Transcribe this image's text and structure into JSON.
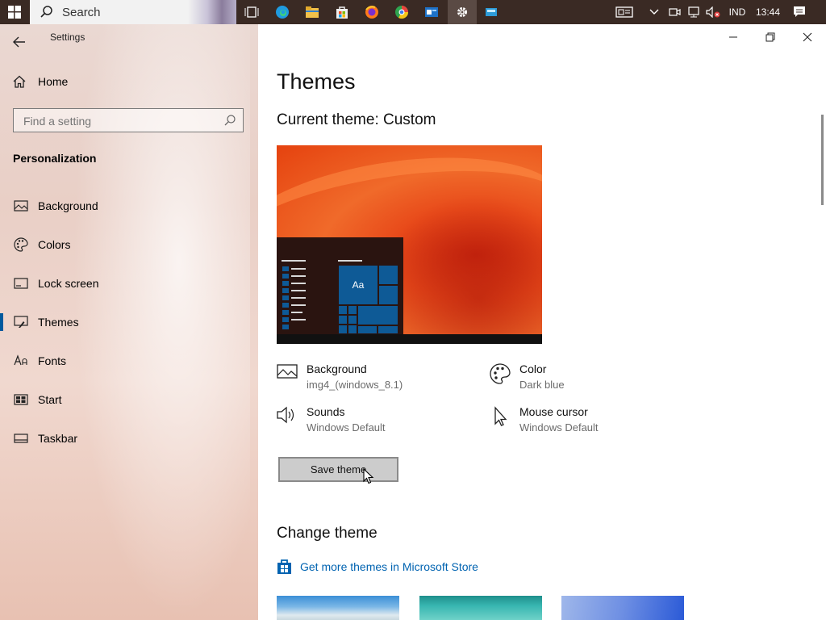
{
  "taskbar": {
    "search_label": "Search",
    "language": "IND",
    "clock": "13:44"
  },
  "window": {
    "title": "Settings"
  },
  "sidebar": {
    "home_label": "Home",
    "search_placeholder": "Find a setting",
    "section_title": "Personalization",
    "items": [
      {
        "label": "Background",
        "icon": "picture-icon"
      },
      {
        "label": "Colors",
        "icon": "palette-icon"
      },
      {
        "label": "Lock screen",
        "icon": "lock-screen-icon"
      },
      {
        "label": "Themes",
        "icon": "themes-brush-icon",
        "selected": true
      },
      {
        "label": "Fonts",
        "icon": "fonts-icon"
      },
      {
        "label": "Start",
        "icon": "start-icon"
      },
      {
        "label": "Taskbar",
        "icon": "taskbar-icon"
      }
    ]
  },
  "main": {
    "title": "Themes",
    "current_theme": "Current theme: Custom",
    "preview_tile_text": "Aa",
    "attributes": {
      "background": {
        "name": "Background",
        "value": "img4_(windows_8.1)"
      },
      "color": {
        "name": "Color",
        "value": "Dark blue"
      },
      "sounds": {
        "name": "Sounds",
        "value": "Windows Default"
      },
      "mouse_cursor": {
        "name": "Mouse cursor",
        "value": "Windows Default"
      }
    },
    "save_button": "Save theme",
    "change_theme_title": "Change theme",
    "store_link": "Get more themes in Microsoft Store"
  },
  "colors": {
    "accent": "#0063b1",
    "selection_bar": "#005a9e",
    "taskbar": "#3a2a24"
  }
}
